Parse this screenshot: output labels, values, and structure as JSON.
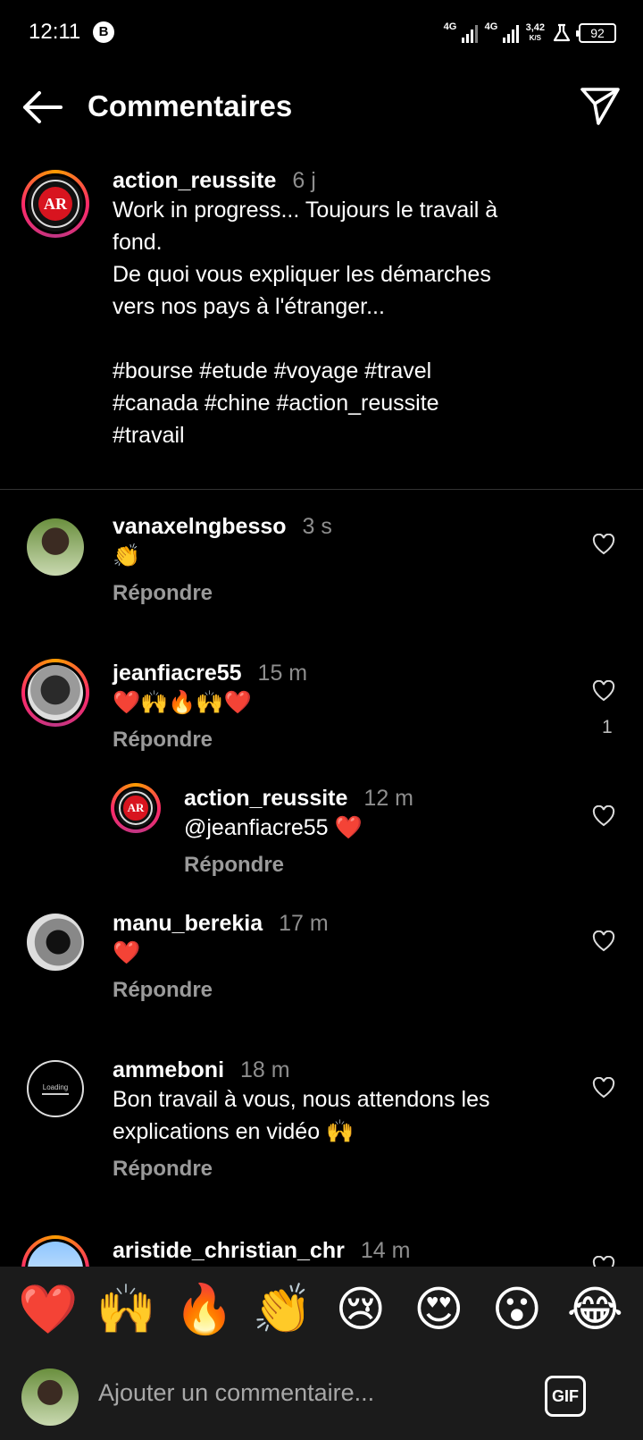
{
  "status_bar": {
    "time": "12:11",
    "badge": "B",
    "net1": "4G",
    "net2": "4G",
    "speed_value": "3,42",
    "speed_unit": "K/S",
    "battery": "92"
  },
  "header": {
    "title": "Commentaires",
    "back_icon": "arrow-left-icon",
    "send_icon": "paper-plane-icon"
  },
  "caption": {
    "user": "action_reussite",
    "time": "6 j",
    "lines": [
      "Work in progress... Toujours le travail à",
      "fond.",
      "De quoi vous expliquer les démarches",
      "vers nos pays à l'étranger...",
      "",
      "#bourse #etude #voyage #travel",
      "#canada #chine #action_reussite",
      "#travail"
    ]
  },
  "comments": [
    {
      "user": "vanaxelngbesso",
      "time": "3 s",
      "text": "👏",
      "reply": "Répondre"
    },
    {
      "user": "jeanfiacre55",
      "time": "15 m",
      "text": "❤️🙌🔥🙌❤️",
      "reply": "Répondre",
      "likes": "1"
    },
    {
      "user": "action_reussite",
      "time": "12 m",
      "text": "@jeanfiacre55 ❤️",
      "reply": "Répondre"
    },
    {
      "user": "manu_berekia",
      "time": "17 m",
      "text": "❤️",
      "reply": "Répondre"
    },
    {
      "user": "ammeboni",
      "time": "18 m",
      "text_line1": "Bon travail à vous, nous attendons les",
      "text_line2": "explications en vidéo 🙌",
      "reply": "Répondre",
      "avatar_text": "Loading"
    },
    {
      "user": "aristide_christian_chr",
      "time": "14 m"
    }
  ],
  "emoji_bar": [
    "❤️",
    "🙌",
    "🔥",
    "👏",
    "😢",
    "😍",
    "😮",
    "😂"
  ],
  "input": {
    "placeholder": "Ajouter un commentaire...",
    "gif_label": "GIF"
  },
  "colors": {
    "background": "#000000",
    "muted_text": "#8e8e8e",
    "panel": "#1b1b1b"
  }
}
